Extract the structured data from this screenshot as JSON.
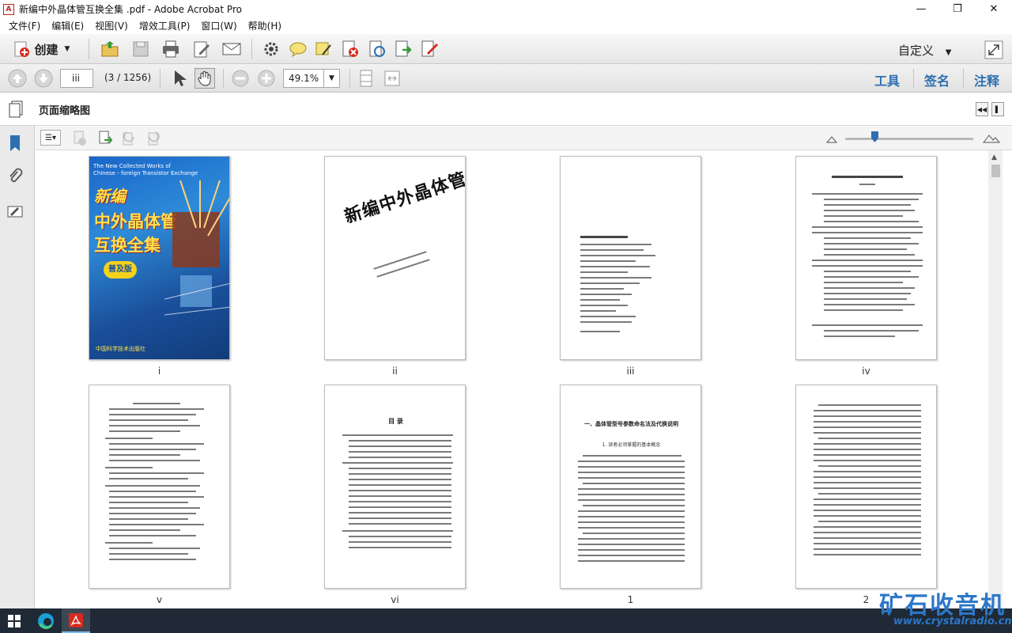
{
  "window": {
    "title": "新编中外晶体管互换全集 .pdf - Adobe Acrobat Pro",
    "controls": [
      "—",
      "❐",
      "✕"
    ]
  },
  "menu": [
    "文件(F)",
    "编辑(E)",
    "视图(V)",
    "增效工具(P)",
    "窗口(W)",
    "帮助(H)"
  ],
  "toolbar": {
    "create_label": "创建",
    "customize_label": "自定义"
  },
  "nav": {
    "page_value": "iii",
    "page_count": "(3 / 1256)",
    "zoom_value": "49.1%"
  },
  "right_tabs": [
    "工具",
    "签名",
    "注释"
  ],
  "panel": {
    "title": "页面缩略图"
  },
  "thumbnails": [
    {
      "label": "i"
    },
    {
      "label": "ii"
    },
    {
      "label": "iii"
    },
    {
      "label": "iv"
    },
    {
      "label": "v"
    },
    {
      "label": "vi"
    },
    {
      "label": "1"
    },
    {
      "label": "2"
    }
  ],
  "cover": {
    "en_line1": "The New Collected Works of",
    "en_line2": "Chinese - foreign Transistor Exchange",
    "big1": "新编",
    "big2": "中外晶体管",
    "big3": "互换全集",
    "badge": "普及版",
    "footer": "中国科学技术出版社"
  },
  "page_ii": {
    "title": "新编中外晶体管互换全集"
  },
  "page_vi": {
    "heading": "目  录"
  },
  "page_1": {
    "heading": "一、晶体管型号参数命名法及代换说明",
    "subheading": "1. 读者必须掌握的基本概念"
  },
  "watermark": {
    "text": "矿石收音机",
    "url": "www.crystalradio.cn"
  },
  "colors": {
    "accent": "#2d6fb0",
    "taskbar": "#1f2a36",
    "watermark": "#2d77c8"
  }
}
